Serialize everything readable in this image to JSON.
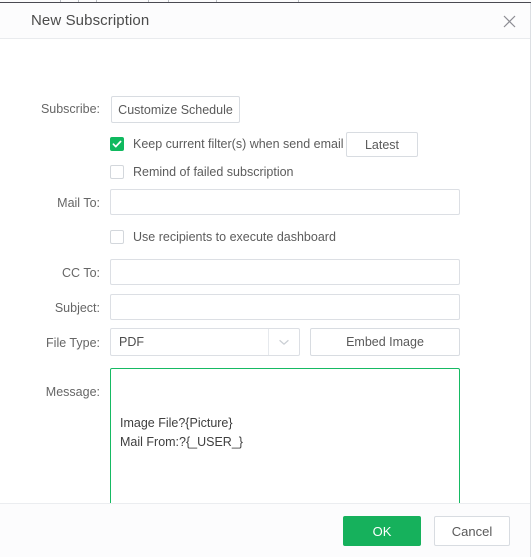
{
  "dialog": {
    "title": "New Subscription",
    "close_icon": "close-icon"
  },
  "form": {
    "subscribe": {
      "label": "Subscribe:",
      "schedule_button": "Customize Schedule",
      "keep_filters": {
        "label": "Keep current filter(s) when send email",
        "checked": true
      },
      "latest_button": "Latest",
      "remind_failed": {
        "label": "Remind of failed subscription",
        "checked": false
      }
    },
    "mail_to": {
      "label": "Mail To:",
      "value": "",
      "placeholder": ""
    },
    "use_recipients": {
      "label": "Use recipients to execute dashboard",
      "checked": false
    },
    "cc_to": {
      "label": "CC To:",
      "value": "",
      "placeholder": ""
    },
    "subject": {
      "label": "Subject:",
      "value": "",
      "placeholder": ""
    },
    "file_type": {
      "label": "File Type:",
      "value": "PDF",
      "arrow_icon": "chevron-down-icon",
      "embed_button": "Embed Image"
    },
    "message": {
      "label": "Message:",
      "value": "Image File?{Picture}\nMail From:?{_USER_}",
      "placeholder": ""
    }
  },
  "footer": {
    "ok_label": "OK",
    "cancel_label": "Cancel"
  },
  "colors": {
    "accent_green": "#16b15c",
    "checkbox_green": "#10b95f",
    "focus_border": "#16ba63",
    "text": "#5c5c5c",
    "label": "#666666",
    "border": "#dcdfe4"
  }
}
